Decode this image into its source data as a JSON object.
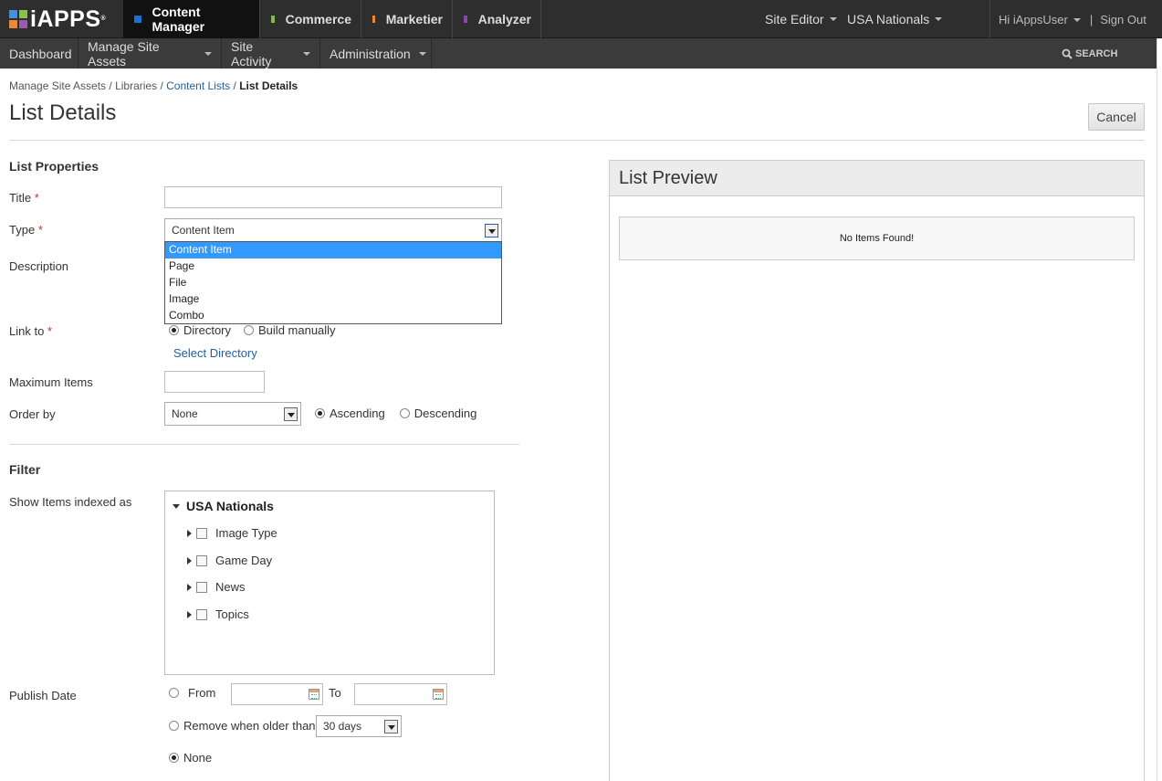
{
  "brand": {
    "logo_text": "iAPPS",
    "logo_colors": [
      "#4a8fd4",
      "#8ac249",
      "#e8883a",
      "#9b59b6"
    ]
  },
  "app_tabs": [
    {
      "label": "Content Manager",
      "color": "#1e6fd0"
    },
    {
      "label": "Commerce",
      "color": "#7fbf3f"
    },
    {
      "label": "Marketier",
      "color": "#f08a24"
    },
    {
      "label": "Analyzer",
      "color": "#8e44ad"
    }
  ],
  "top_right": {
    "site_editor": "Site Editor",
    "site": "USA Nationals",
    "greeting": "Hi  iAppsUser",
    "separator": "|",
    "sign_out": "Sign Out"
  },
  "nav": {
    "items": [
      {
        "label": "Dashboard"
      },
      {
        "label": "Manage Site Assets"
      },
      {
        "label": "Site Activity"
      },
      {
        "label": "Administration"
      }
    ],
    "search_label": "SEARCH"
  },
  "breadcrumb": {
    "item1": "Manage Site Assets",
    "item2": "Libraries",
    "item3": "Content Lists",
    "current": "List Details",
    "sep": " / "
  },
  "page": {
    "title": "List Details",
    "cancel": "Cancel"
  },
  "list_properties": {
    "heading": "List Properties",
    "title_label": "Title",
    "title_value": "",
    "type_label": "Type",
    "type_value": "Content Item",
    "type_options": [
      "Content Item",
      "Page",
      "File",
      "Image",
      "Combo"
    ],
    "description_label": "Description",
    "link_to_label": "Link to",
    "link_directory": "Directory",
    "link_manual": "Build manually",
    "select_directory": "Select Directory",
    "max_items_label": "Maximum Items",
    "max_items_value": "",
    "order_by_label": "Order by",
    "order_by_value": "None",
    "ascending": "Ascending",
    "descending": "Descending",
    "required_mark": "*"
  },
  "filter": {
    "heading": "Filter",
    "show_items_label": "Show Items indexed as",
    "tree_root": "USA Nationals",
    "tree_items": [
      "Image Type",
      "Game Day",
      "News",
      "Topics"
    ],
    "publish_date_label": "Publish Date",
    "from_label": "From",
    "to_label": "To",
    "remove_older_label": "Remove when older than",
    "remove_older_value": "30 days",
    "none_label": "None"
  },
  "preview": {
    "heading": "List Preview",
    "empty_message": "No Items Found!"
  }
}
